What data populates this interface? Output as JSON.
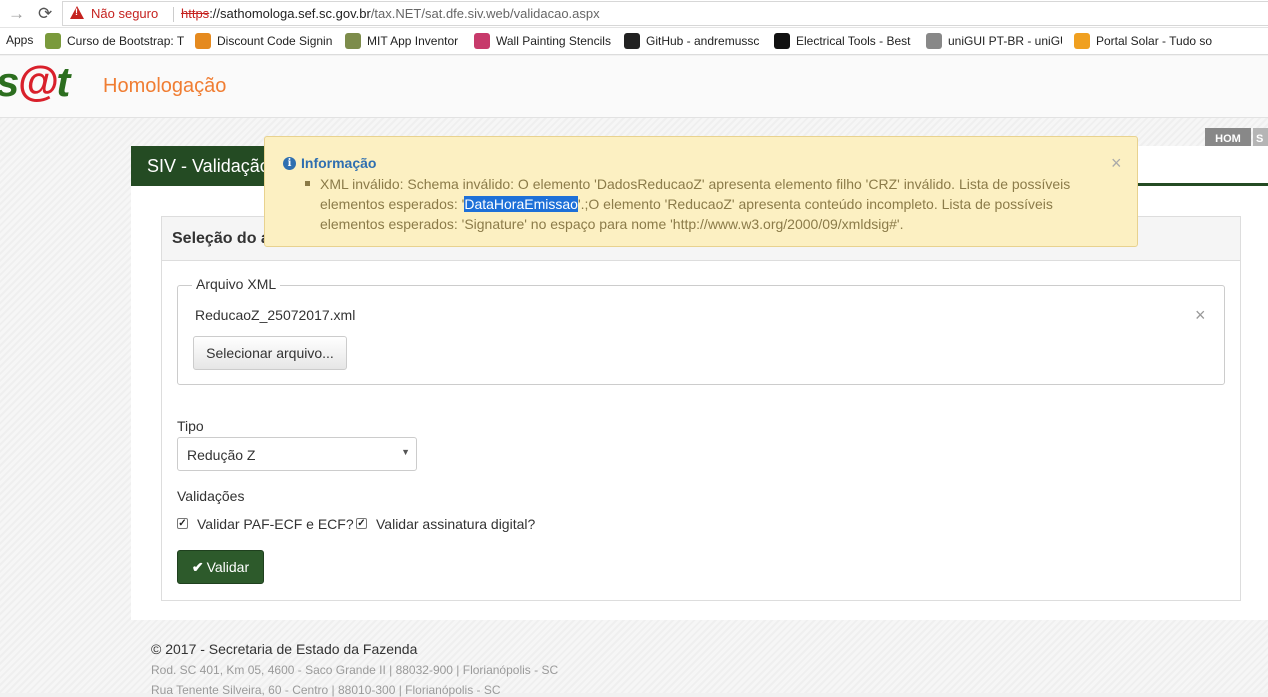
{
  "browser": {
    "security_label": "Não seguro",
    "url_scheme": "https",
    "url_host": "://sathomologa.sef.sc.gov.br",
    "url_path": "/tax.NET/sat.dfe.siv.web/validacao.aspx"
  },
  "bookmarks": [
    {
      "label": "Apps",
      "icon": "apps-grid-icon",
      "color": "#4a4a4a"
    },
    {
      "label": "Curso de Bootstrap: T",
      "icon": "bootstrap-course-icon",
      "color": "#7a9a3c"
    },
    {
      "label": "Discount Code Signin",
      "icon": "discount-code-icon",
      "color": "#e58a1f"
    },
    {
      "label": "MIT App Inventor",
      "icon": "app-inventor-icon",
      "color": "#7d8c4b"
    },
    {
      "label": "Wall Painting Stencils",
      "icon": "stencil-icon",
      "color": "#c73a6b"
    },
    {
      "label": "GitHub - andremussc",
      "icon": "github-icon",
      "color": "#222222"
    },
    {
      "label": "Electrical Tools - Best",
      "icon": "electrical-tools-icon",
      "color": "#111111"
    },
    {
      "label": "uniGUI PT-BR - uniGU",
      "icon": "document-icon",
      "color": "#888888"
    },
    {
      "label": "Portal Solar - Tudo so",
      "icon": "portal-solar-icon",
      "color": "#f0a020"
    }
  ],
  "header": {
    "logo_s": "s",
    "logo_at": "@",
    "logo_t": "t",
    "env_title": "Homologação",
    "env_tab_1": "HOM",
    "env_tab_2": "S"
  },
  "page": {
    "title": "SIV - Validação",
    "card_title": "Seleção do a"
  },
  "alert": {
    "title": "Informação",
    "close": "×",
    "msg_before": "XML inválido: Schema inválido: O elemento 'DadosReducaoZ' apresenta elemento filho 'CRZ' inválido. Lista de possíveis elementos esperados: '",
    "msg_highlight": "DataHoraEmissao",
    "msg_after": "'.;O elemento 'ReducaoZ' apresenta conteúdo incompleto. Lista de possíveis elementos esperados: 'Signature' no espaço para nome 'http://www.w3.org/2000/09/xmldsig#'."
  },
  "form": {
    "xml_legend": "Arquivo XML",
    "file_name": "ReducaoZ_25072017.xml",
    "file_remove": "×",
    "select_button": "Selecionar arquivo...",
    "tipo_label": "Tipo",
    "tipo_value": "Redução Z",
    "validacoes_label": "Validações",
    "check_paf": "Validar PAF-ECF e ECF?",
    "check_paf_checked": true,
    "check_sig": "Validar assinatura digital?",
    "check_sig_checked": true,
    "validar_button": "Validar"
  },
  "footer": {
    "copyright": "© 2017 - Secretaria de Estado da Fazenda",
    "address_1": "Rod. SC 401, Km 05, 4600 - Saco Grande II | 88032-900 | Florianópolis - SC",
    "address_2": "Rua Tenente Silveira, 60 - Centro | 88010-300 | Florianópolis - SC"
  },
  "colors": {
    "brand_green": "#244b23",
    "button_green": "#2d5a2b",
    "env_orange": "#f07d32",
    "alert_bg": "#fcf0c2",
    "alert_title": "#2f6fb0",
    "insecure_red": "#c5221f"
  }
}
